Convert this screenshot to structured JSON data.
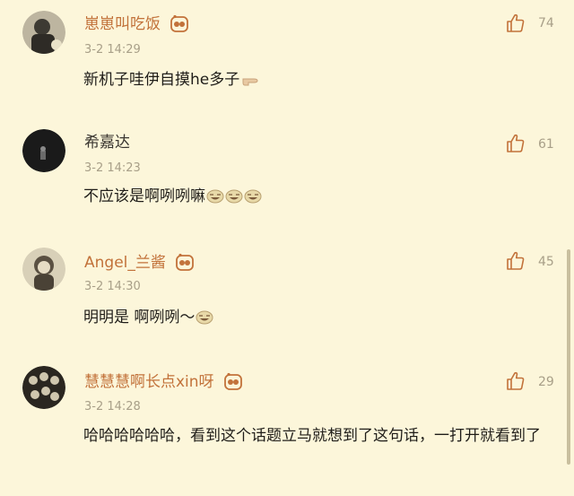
{
  "colors": {
    "background": "#fcf6da",
    "name_orange": "#c2723a",
    "meta": "#a89f88"
  },
  "comments": [
    {
      "name": "崽崽叫吃饭",
      "time": "3-2 14:29",
      "text": "新机子哇伊自摸he多子",
      "likes": "74",
      "name_style": "orange",
      "has_badge": true,
      "emojis": [
        "pointing-hand-icon"
      ]
    },
    {
      "name": "希嘉达",
      "time": "3-2 14:23",
      "text": "不应该是啊咧咧嘛",
      "likes": "61",
      "name_style": "dark",
      "has_badge": false,
      "emojis": [
        "laughing-emoji-icon",
        "laughing-emoji-icon",
        "laughing-emoji-icon"
      ]
    },
    {
      "name": "Angel_兰酱",
      "time": "3-2 14:30",
      "text": "明明是 啊咧咧～",
      "likes": "45",
      "name_style": "orange",
      "has_badge": true,
      "emojis": [
        "laughing-emoji-icon"
      ]
    },
    {
      "name": "慧慧慧啊长点xin呀",
      "time": "3-2 14:28",
      "text": "哈哈哈哈哈哈，看到这个话题立马就想到了这句话，一打开就看到了",
      "likes": "29",
      "name_style": "orange",
      "has_badge": true,
      "emojis": []
    }
  ]
}
